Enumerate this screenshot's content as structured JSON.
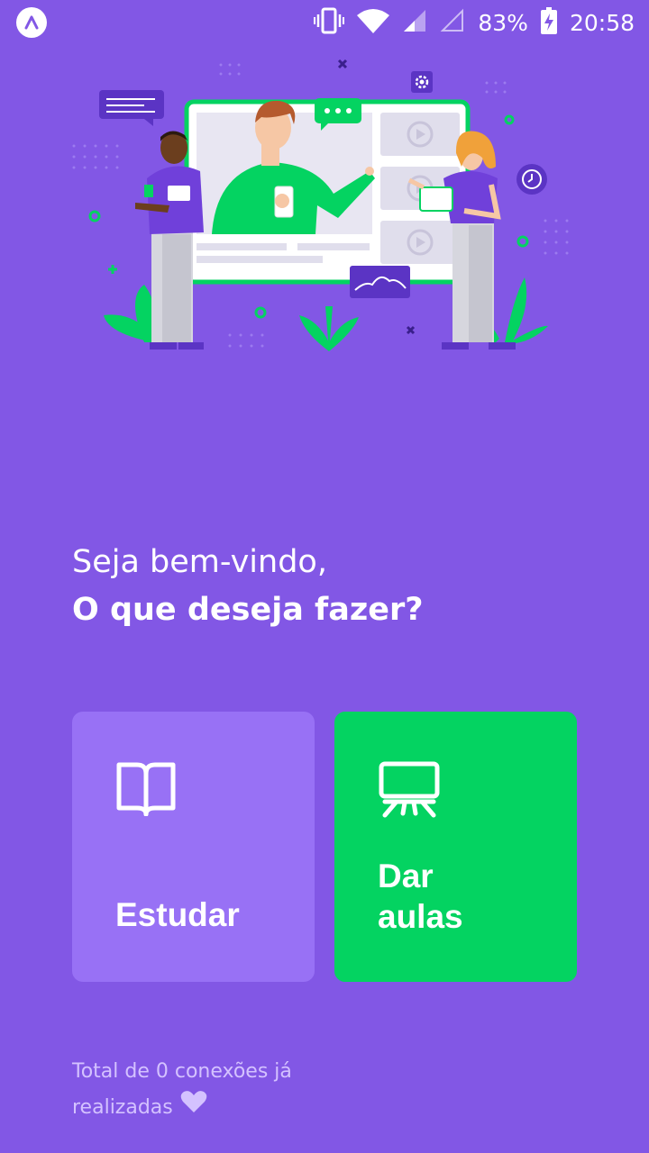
{
  "status_bar": {
    "battery": "83%",
    "time": "20:58",
    "icons": [
      "vibrate-icon",
      "wifi-icon",
      "signal-icon",
      "signal-empty-icon",
      "battery-charging-icon"
    ]
  },
  "welcome": {
    "line1": "Seja bem-vindo,",
    "line2": "O que deseja fazer?"
  },
  "actions": {
    "study": {
      "label": "Estudar",
      "icon": "book-open-icon",
      "color": "#9871F5"
    },
    "teach": {
      "label": "Dar\naulas",
      "icon": "presentation-board-icon",
      "color": "#04D361"
    }
  },
  "footer": {
    "connections_text": "Total de 0 conexões já realizadas",
    "icon": "heart-icon"
  },
  "colors": {
    "background": "#8257E5",
    "primary_light": "#9871F5",
    "secondary": "#04D361",
    "text_muted": "#D4C2FF"
  }
}
